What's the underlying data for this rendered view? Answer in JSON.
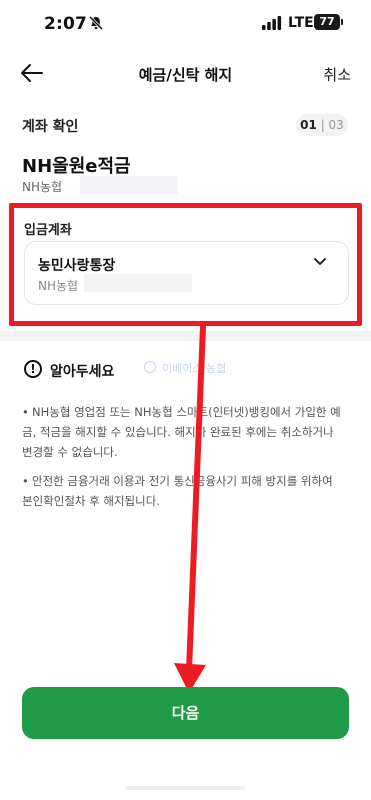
{
  "status_bar": {
    "time": "2:07",
    "network": "LTE",
    "battery": "77"
  },
  "nav": {
    "title": "예금/신탁 해지",
    "cancel_label": "취소"
  },
  "step": {
    "label": "계좌 확인",
    "current": "01",
    "total": "03"
  },
  "product": {
    "name": "NH올원e적금",
    "account_prefix": "NH농협"
  },
  "deposit": {
    "label": "입금계좌",
    "account_name": "농민사랑통장",
    "bank_prefix": "NH농협"
  },
  "notice": {
    "title": "알아두세요",
    "items": [
      "NH농협 영업점 또는 NH농협 스마트(인터넷)뱅킹에서 가입한 예금, 적금을 해지할 수 있습니다. 해지가 완료된 후에는 취소하거나 변경할 수 없습니다.",
      "안전한 금융거래 이용과 전기 통신금융사기 피해 방지를 위하여 본인확인절차 후 해지됩니다."
    ]
  },
  "watermark": "이베이스 농협",
  "next_button_label": "다음",
  "colors": {
    "primary": "#1f9a46",
    "highlight": "#ee1b24"
  }
}
